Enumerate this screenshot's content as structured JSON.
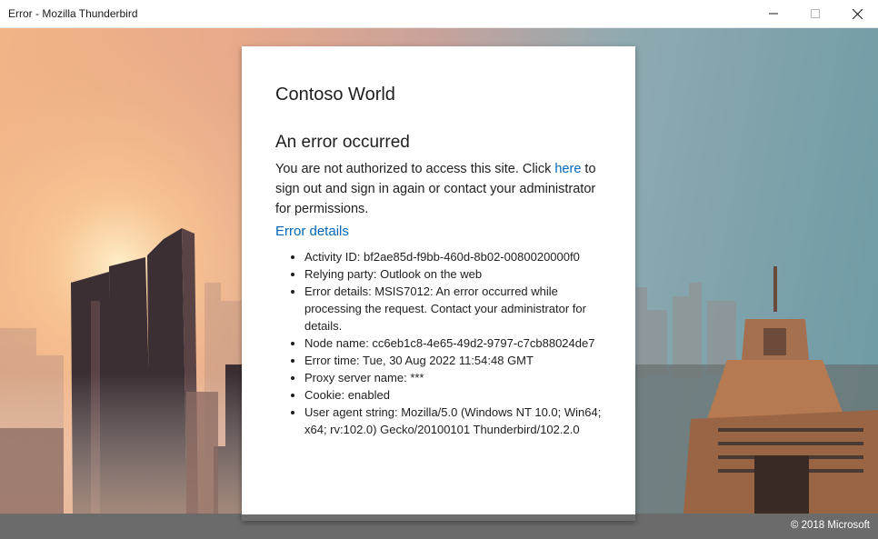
{
  "window": {
    "title": "Error - Mozilla Thunderbird",
    "minimize_icon": "minimize-icon",
    "maximize_icon": "maximize-icon",
    "close_icon": "close-icon"
  },
  "card": {
    "brand": "Contoso World",
    "heading": "An error occurred",
    "message_before": "You are not authorized to access this site. Click ",
    "message_link": "here",
    "message_after": " to sign out and sign in again or contact your administrator for permissions.",
    "details_link": "Error details",
    "details": [
      "Activity ID: bf2ae85d-f9bb-460d-8b02-0080020000f0",
      "Relying party: Outlook on the web",
      "Error details: MSIS7012: An error occurred while processing the request. Contact your administrator for details.",
      "Node name: cc6eb1c8-4e65-49d2-9797-c7cb88024de7",
      "Error time: Tue, 30 Aug 2022 11:54:48 GMT",
      "Proxy server name: ***",
      "Cookie: enabled",
      "User agent string: Mozilla/5.0 (Windows NT 10.0; Win64; x64; rv:102.0) Gecko/20100101 Thunderbird/102.2.0"
    ]
  },
  "footer": {
    "copyright": "© 2018 Microsoft"
  },
  "colors": {
    "link": "#0067b8",
    "footer": "#6b6b6b"
  }
}
